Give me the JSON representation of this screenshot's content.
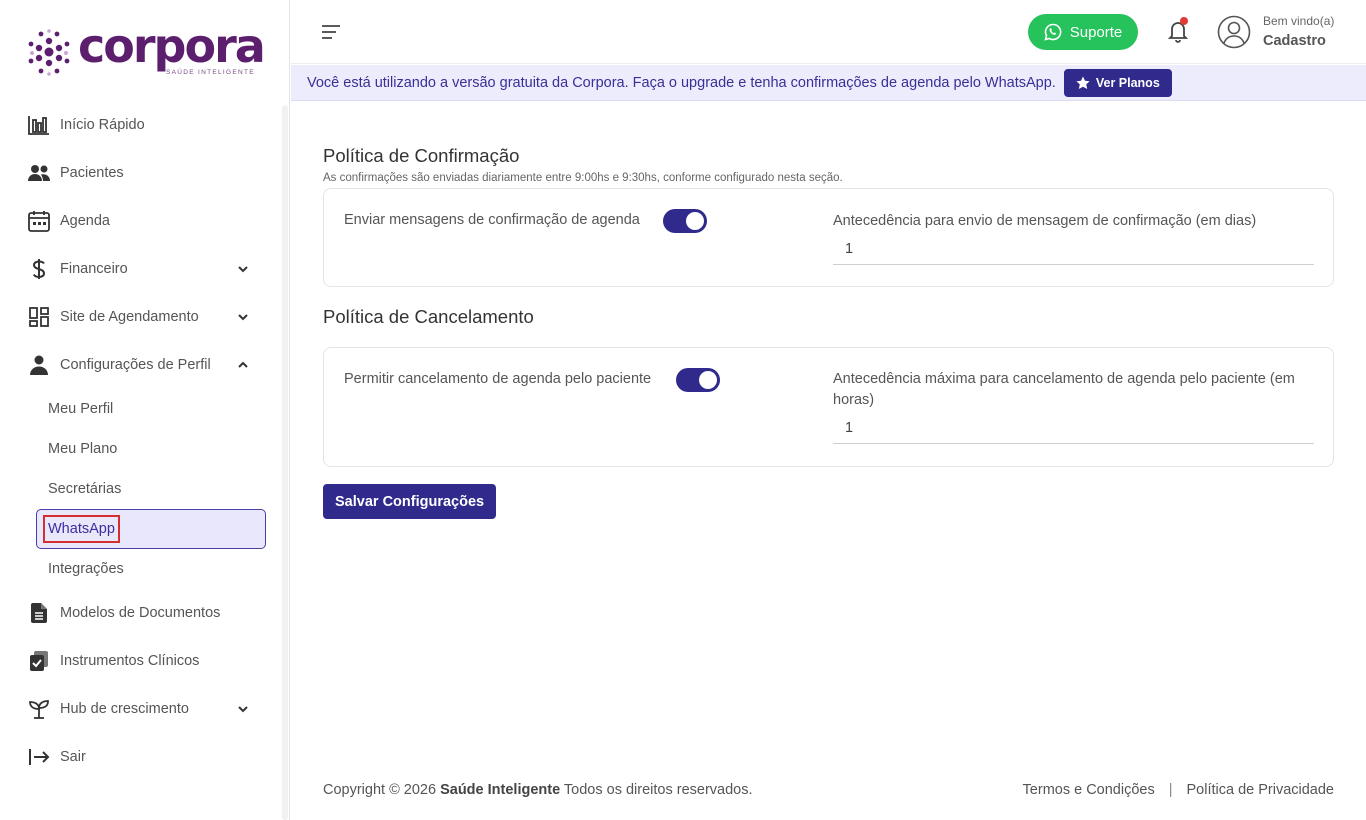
{
  "logo": {
    "word": "corpora",
    "tagline": "SAÚDE INTELIGENTE"
  },
  "sidebar": {
    "items": [
      {
        "label": "Início Rápido",
        "icon": "bar-chart-icon"
      },
      {
        "label": "Pacientes",
        "icon": "users-icon"
      },
      {
        "label": "Agenda",
        "icon": "calendar-icon"
      },
      {
        "label": "Financeiro",
        "icon": "dollar-icon",
        "expandable": true
      },
      {
        "label": "Site de Agendamento",
        "icon": "grid-icon",
        "expandable": true
      },
      {
        "label": "Configurações de Perfil",
        "icon": "user-icon",
        "expanded": true
      }
    ],
    "subitems": [
      {
        "label": "Meu Perfil"
      },
      {
        "label": "Meu Plano"
      },
      {
        "label": "Secretárias"
      },
      {
        "label": "WhatsApp",
        "active": true
      },
      {
        "label": "Integrações"
      }
    ],
    "items_after": [
      {
        "label": "Modelos de Documentos",
        "icon": "document-icon"
      },
      {
        "label": "Instrumentos Clínicos",
        "icon": "clipboard-icon"
      },
      {
        "label": "Hub de crescimento",
        "icon": "sprout-icon",
        "expandable": true
      },
      {
        "label": "Sair",
        "icon": "logout-icon"
      }
    ]
  },
  "header": {
    "support_label": "Suporte",
    "welcome": "Bem vindo(a)",
    "username": "Cadastro"
  },
  "banner": {
    "text": "Você está utilizando a versão gratuita da Corpora. Faça o upgrade e tenha confirmações de agenda pelo WhatsApp.",
    "button_label": "Ver Planos"
  },
  "confirmation": {
    "title": "Política de Confirmação",
    "subtitle": "As confirmações são enviadas diariamente entre 9:00hs e 9:30hs, conforme configurado nesta seção.",
    "toggle_label": "Enviar mensagens de confirmação de agenda",
    "toggle_on": true,
    "field_label": "Antecedência para envio de mensagem de confirmação (em dias)",
    "field_value": "1"
  },
  "cancellation": {
    "title": "Política de Cancelamento",
    "toggle_label": "Permitir cancelamento de agenda pelo paciente",
    "toggle_on": true,
    "field_label": "Antecedência máxima para cancelamento de agenda pelo paciente (em horas)",
    "field_value": "1"
  },
  "save_label": "Salvar Configurações",
  "footer": {
    "copyright_prefix": "Copyright © 2026 ",
    "brand": "Saúde Inteligente",
    "copyright_suffix": " Todos os direitos reservados.",
    "terms": "Termos e Condições",
    "privacy": "Política de Privacidade"
  },
  "colors": {
    "primary": "#2f2a8c",
    "success": "#26c25c",
    "brand": "#5c1f6e",
    "banner_bg": "#ececfd"
  }
}
